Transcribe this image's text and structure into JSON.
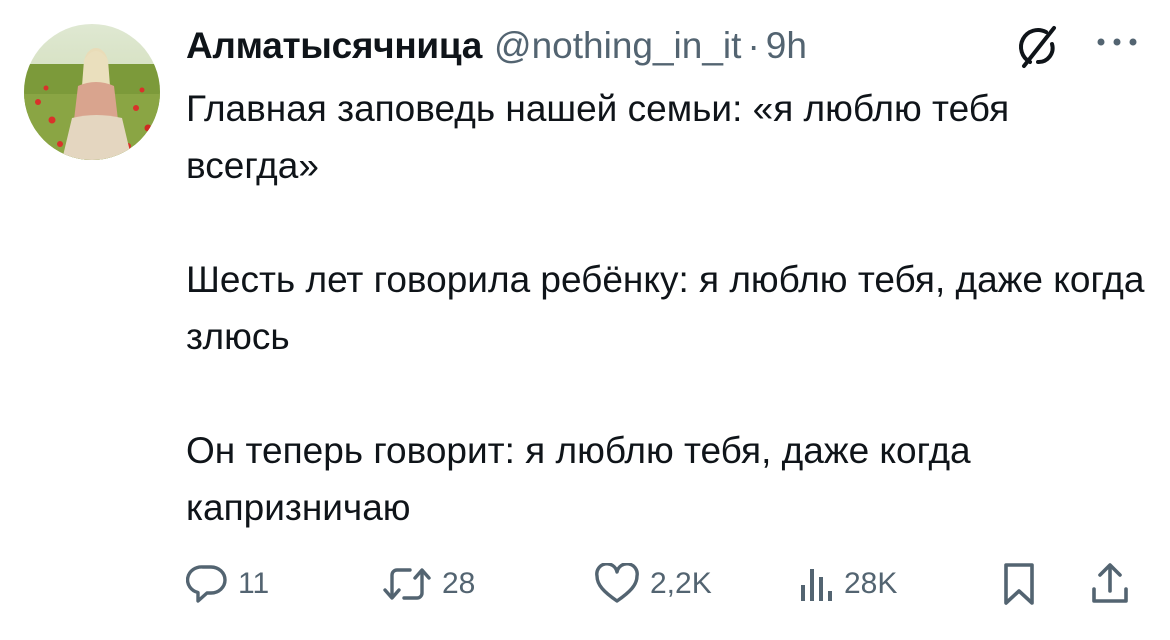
{
  "tweet": {
    "author": {
      "display_name": "Алматысячница",
      "handle": "@nothing_in_it",
      "separator": "·",
      "time": "9h",
      "avatar_icon": "user-avatar-photo"
    },
    "text": {
      "paragraphs": [
        "Главная заповедь нашей семьи: «я люблю тебя всегда»",
        "Шесть лет говорила ребёнку: я люблю тебя, даже когда злюсь",
        "Он теперь говорит: я люблю тебя, даже когда капризничаю"
      ]
    },
    "actions": {
      "reply": {
        "icon": "reply-icon",
        "count": "11"
      },
      "repost": {
        "icon": "repost-icon",
        "count": "28"
      },
      "like": {
        "icon": "heart-icon",
        "count": "2,2K"
      },
      "views": {
        "icon": "views-icon",
        "count": "28K"
      },
      "bookmark": {
        "icon": "bookmark-icon"
      },
      "share": {
        "icon": "share-icon"
      }
    },
    "top_icons": {
      "grok": "grok-icon",
      "more": "more-icon"
    }
  },
  "colors": {
    "text_primary": "#0f1419",
    "text_secondary": "#536471",
    "background": "#ffffff"
  }
}
